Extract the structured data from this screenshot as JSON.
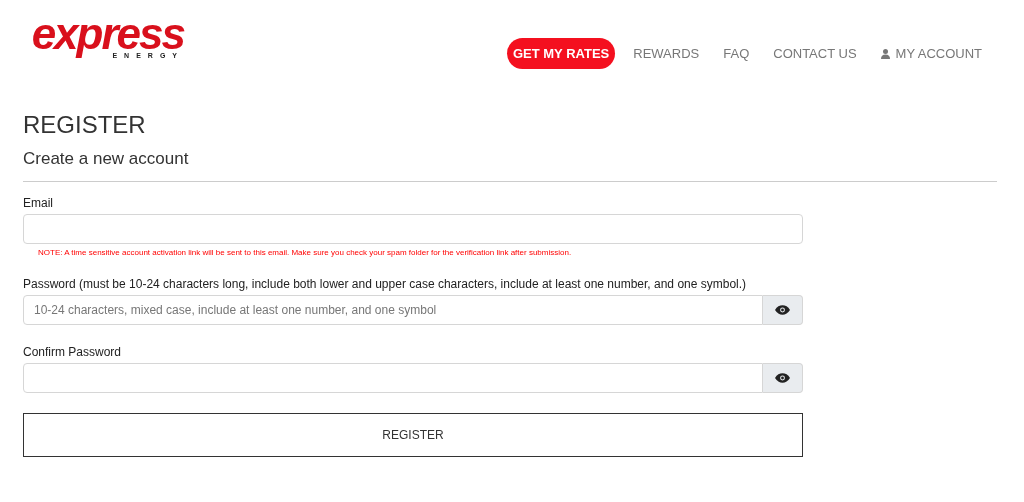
{
  "logo": {
    "brand": "express",
    "tagline": "ENERGY"
  },
  "nav": [
    {
      "label": "GET MY RATES",
      "kind": "cta"
    },
    {
      "label": "REWARDS",
      "kind": "link"
    },
    {
      "label": "FAQ",
      "kind": "link"
    },
    {
      "label": "CONTACT US",
      "kind": "link"
    },
    {
      "label": "MY ACCOUNT",
      "kind": "account"
    }
  ],
  "heading": "REGISTER",
  "subheading": "Create a new account",
  "fields": [
    {
      "label": "Email",
      "kind": "email",
      "note": "NOTE: A time sensitive account activation link will be sent to this email. Make sure you check your spam folder for the verification link after submission."
    },
    {
      "label": "Password (must be 10-24 characters long, include both lower and upper case characters, include at least one number, and one symbol.)",
      "kind": "password",
      "placeholder": "10-24 characters, mixed case, include at least one number, and one symbol"
    },
    {
      "label": "Confirm Password",
      "kind": "password"
    }
  ],
  "submit": "REGISTER"
}
